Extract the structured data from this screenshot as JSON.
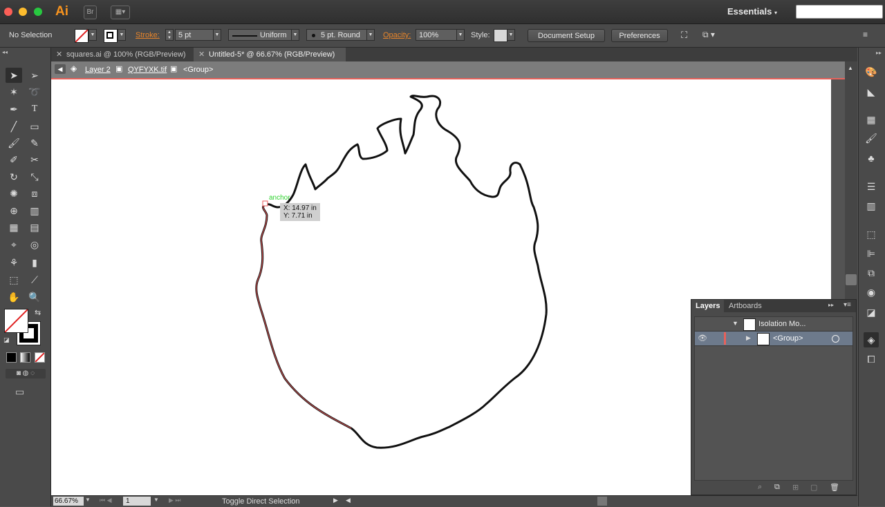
{
  "app": {
    "logo": "Ai",
    "bridge_label": "Br",
    "workspace": "Essentials"
  },
  "control": {
    "selection": "No Selection",
    "stroke_label": "Stroke:",
    "stroke_value": "5 pt",
    "profile": "Uniform",
    "brush": "5 pt. Round",
    "opacity_label": "Opacity:",
    "opacity_value": "100%",
    "style_label": "Style:",
    "document_setup": "Document Setup",
    "preferences": "Preferences"
  },
  "tabs": [
    {
      "label": "squares.ai @ 100% (RGB/Preview)",
      "active": false
    },
    {
      "label": "Untitled-5* @ 66.67% (RGB/Preview)",
      "active": true
    }
  ],
  "isolation": {
    "layer": "Layer 2",
    "image": "QYFYXK.tif",
    "group": "<Group>"
  },
  "canvas": {
    "anchor_label": "anchor",
    "coord_x": "X: 14.97 in",
    "coord_y": "Y: 7.71 in"
  },
  "layers_panel": {
    "tab_layers": "Layers",
    "tab_artboards": "Artboards",
    "rows": [
      {
        "label": "Isolation Mo..."
      },
      {
        "label": "<Group>"
      }
    ]
  },
  "status": {
    "zoom": "66.67%",
    "page": "1",
    "message": "Toggle Direct Selection"
  },
  "colors": {
    "accent": "#e8852a",
    "isolation_border": "#e8615a",
    "anchor_green": "#2ed12e"
  }
}
